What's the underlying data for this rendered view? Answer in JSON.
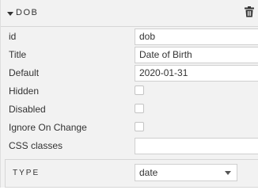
{
  "panel": {
    "title": "DOB",
    "caret_icon": "caret-down-icon",
    "delete_icon": "trash-icon"
  },
  "fields": {
    "id": {
      "label": "id",
      "value": "dob"
    },
    "title": {
      "label": "Title",
      "value": "Date of Birth"
    },
    "default": {
      "label": "Default",
      "value": "2020-01-31"
    },
    "hidden": {
      "label": "Hidden",
      "checked": false
    },
    "disabled": {
      "label": "Disabled",
      "checked": false
    },
    "ignore_on_change": {
      "label": "Ignore On Change",
      "checked": false
    },
    "css_classes": {
      "label": "CSS classes",
      "value": ""
    }
  },
  "type_section": {
    "label": "TYPE",
    "selected": "date",
    "dropdown_icon": "chevron-down-icon"
  }
}
